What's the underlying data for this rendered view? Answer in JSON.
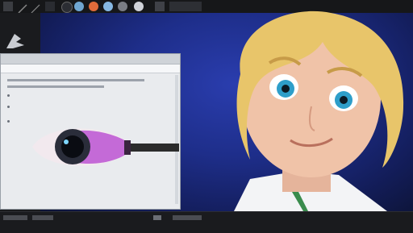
{
  "colors": {
    "topbar": "#161719",
    "panel": "#1a1b1e",
    "accent_blue": "#2a3dae",
    "doc_bg": "#e9ebee"
  },
  "toolbar": {
    "icons": [
      "circle-icon",
      "pen-icon",
      "line-icon",
      "grid-icon",
      "eye-icon",
      "shield-icon",
      "palette-icon",
      "diamond-icon",
      "gear-icon",
      "bag-icon",
      "droplet-icon",
      "layers-icon",
      "square-icon"
    ]
  },
  "document": {
    "title": ""
  },
  "statusbar": {
    "items": [
      "",
      "",
      ""
    ]
  }
}
